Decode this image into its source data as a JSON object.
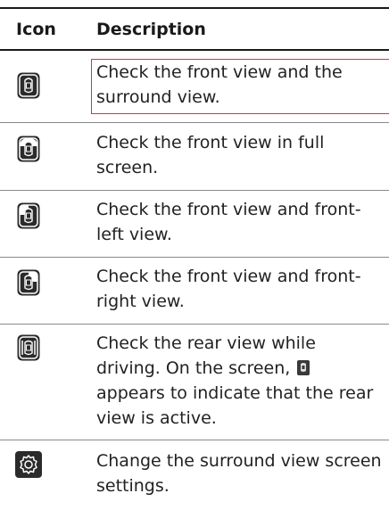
{
  "header": {
    "icon": "Icon",
    "description": "Description"
  },
  "rows": [
    {
      "icon": "front-surround-view-icon",
      "text": "Check the front view and the surround view."
    },
    {
      "icon": "front-full-view-icon",
      "text": "Check the front view in full screen."
    },
    {
      "icon": "front-left-view-icon",
      "text": "Check the front view and front-left view."
    },
    {
      "icon": "front-right-view-icon",
      "text": "Check the front view and front-right view."
    },
    {
      "icon": "rear-view-driving-icon",
      "text_parts": [
        "Check the rear view while driving. On the screen,",
        "appears to indicate that the rear view is active."
      ],
      "inline_icon": "rear-view-active-indicator-icon"
    },
    {
      "icon": "gear-icon",
      "text": "Change the surround view screen settings."
    }
  ],
  "colors": {
    "rule": "#1a1a1a",
    "separator": "#8a8a8a",
    "highlight": "#e0333a",
    "icon_fill": "#2b2b2b"
  }
}
